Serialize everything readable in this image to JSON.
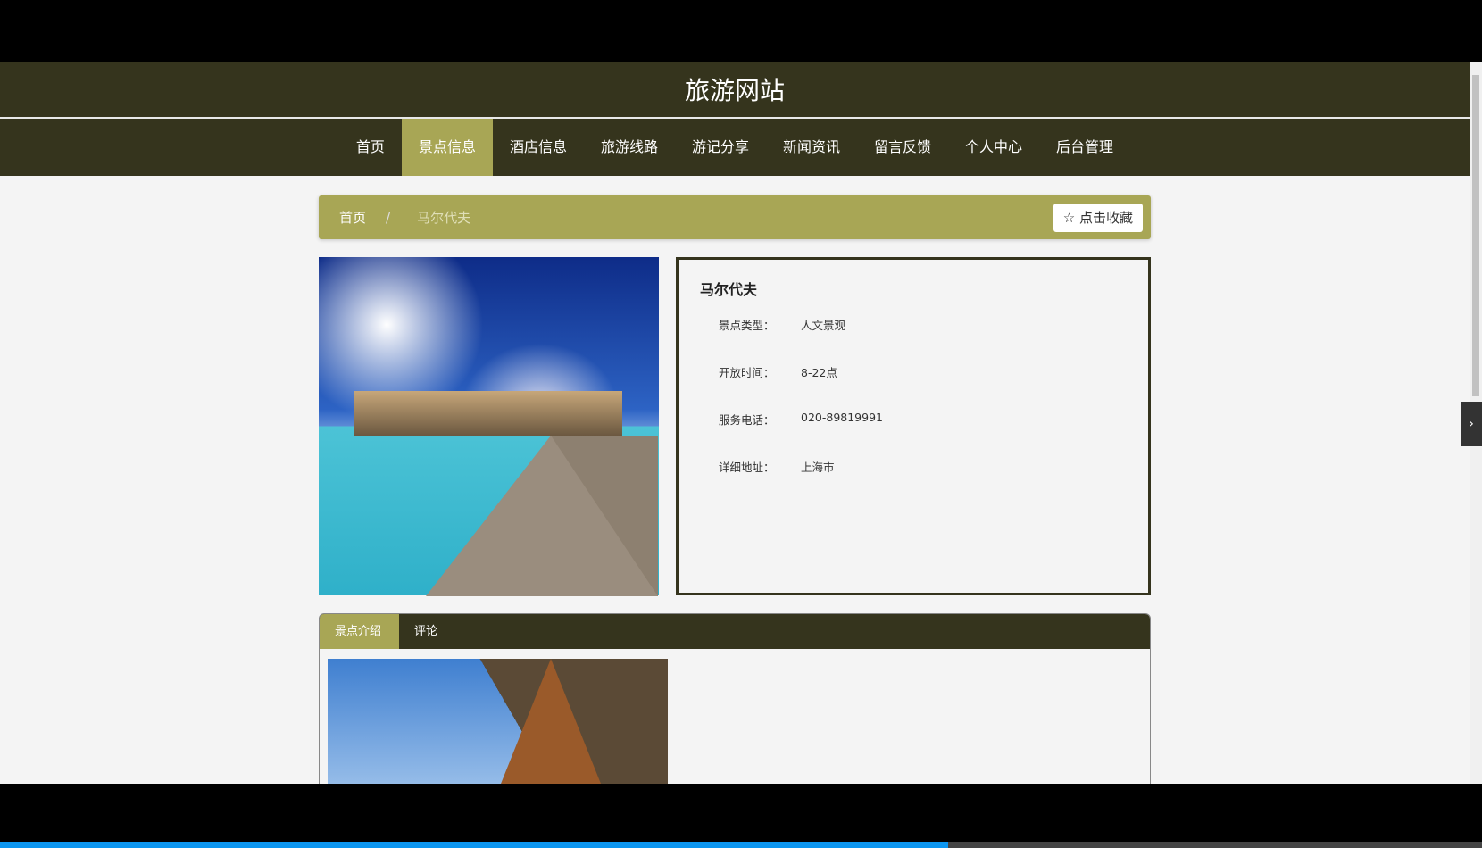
{
  "site_title": "旅游网站",
  "nav": [
    {
      "label": "首页"
    },
    {
      "label": "景点信息",
      "active": true
    },
    {
      "label": "酒店信息"
    },
    {
      "label": "旅游线路"
    },
    {
      "label": "游记分享"
    },
    {
      "label": "新闻资讯"
    },
    {
      "label": "留言反馈"
    },
    {
      "label": "个人中心"
    },
    {
      "label": "后台管理"
    }
  ],
  "breadcrumb": {
    "home": "首页",
    "separator": "/",
    "current": "马尔代夫"
  },
  "favorite_button": "点击收藏",
  "attraction": {
    "name": "马尔代夫",
    "fields": [
      {
        "label": "景点类型：",
        "value": "人文景观"
      },
      {
        "label": "开放时间：",
        "value": "8-22点"
      },
      {
        "label": "服务电话：",
        "value": "020-89819991"
      },
      {
        "label": "详细地址：",
        "value": "上海市"
      }
    ]
  },
  "tabs": [
    {
      "label": "景点介绍"
    },
    {
      "label": "评论"
    }
  ],
  "video_progress_percent": 64
}
